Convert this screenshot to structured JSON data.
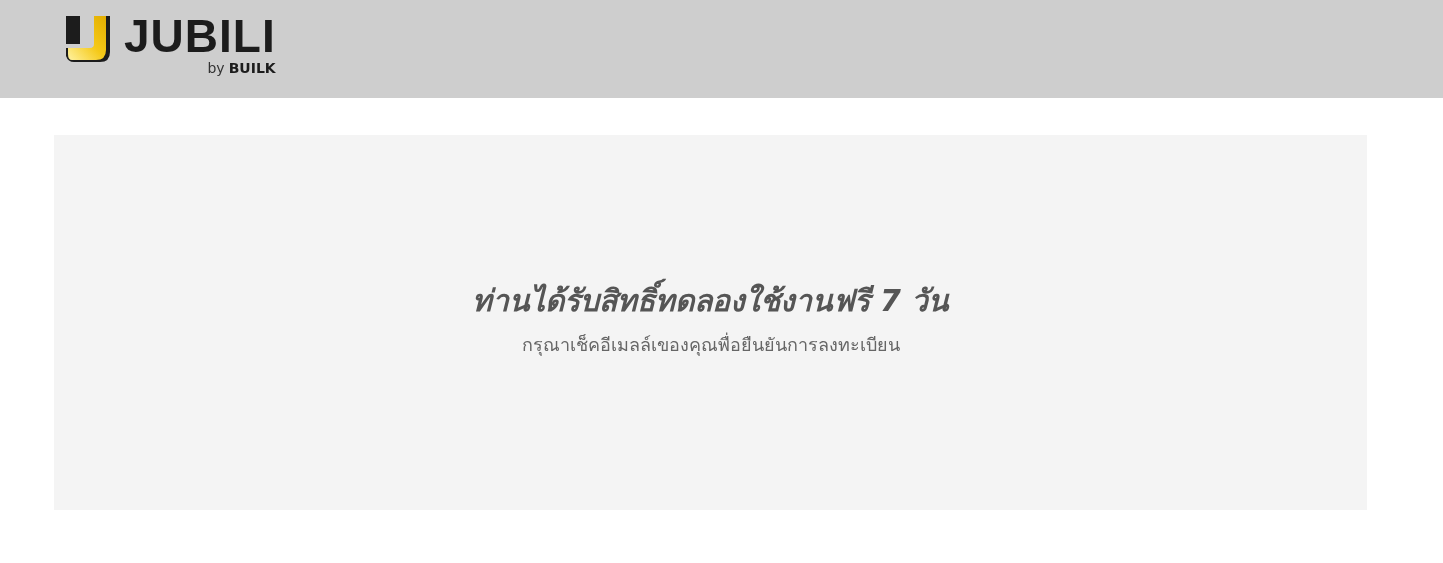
{
  "header": {
    "logo": {
      "name": "JUBILI",
      "by": "by",
      "company": "BUILK"
    }
  },
  "message": {
    "title": "ท่านได้รับสิทธิ์ทดลองใช้งานฟรี 7 วัน",
    "subtitle": "กรุณาเช็คอีเมลล์เของคุณพื่อยืนยันการลงทะเบียน"
  }
}
